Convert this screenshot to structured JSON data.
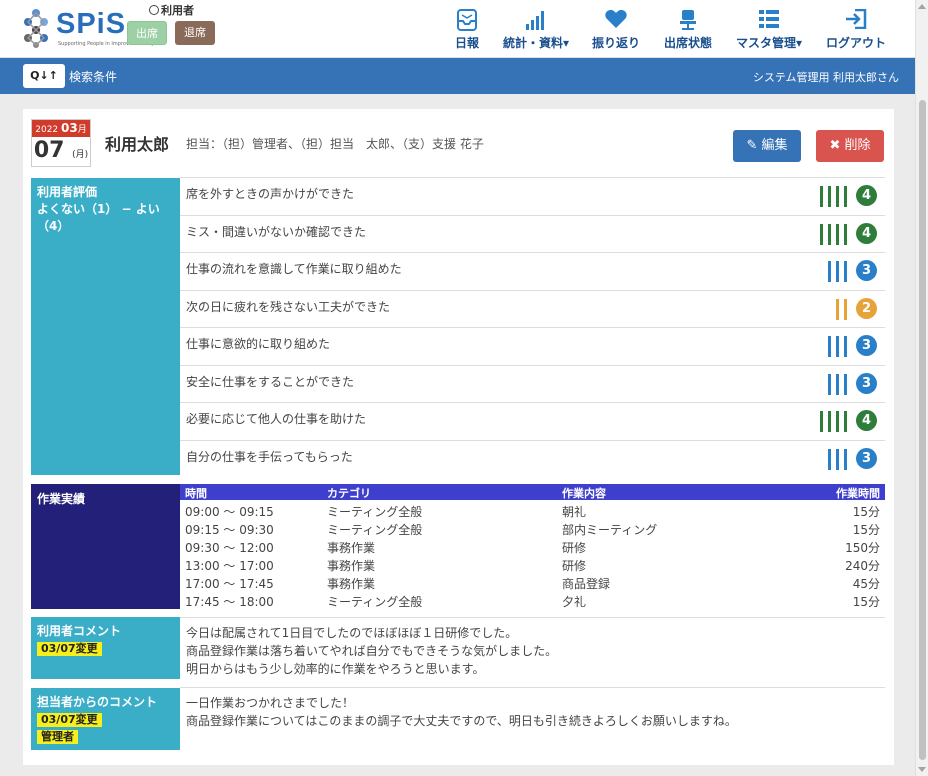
{
  "header": {
    "logo_text": "SPiS",
    "logo_sub": "Supporting People in Improve Stability",
    "user_label": "利用者",
    "btn_in": "出席",
    "btn_out": "退席",
    "nav": [
      {
        "label": "日報",
        "icon": "inbox-icon"
      },
      {
        "label": "統計・資料▾",
        "icon": "bar-chart-icon"
      },
      {
        "label": "振り返り",
        "icon": "heart-icon"
      },
      {
        "label": "出席状態",
        "icon": "chair-icon"
      },
      {
        "label": "マスタ管理▾",
        "icon": "list-icon"
      },
      {
        "label": "ログアウト",
        "icon": "logout-icon"
      }
    ]
  },
  "subbar": {
    "search_button": "Q↓↑",
    "search_label": "検索条件",
    "system_user": "システム管理用 利用太郎さん"
  },
  "report": {
    "date": {
      "year": "2022",
      "month": "03",
      "month_suffix": "月",
      "day": "07",
      "weekday": "(月)"
    },
    "name": "利用太郎",
    "staff": "担当：（担）管理者、（担）担当　太郎、（支）支援 花子",
    "edit_label": "編集",
    "delete_label": "削除"
  },
  "evaluation": {
    "label_line1": "利用者評価",
    "label_line2": "よくない（1） − よい（4）",
    "items": [
      {
        "text": "席を外すときの声かけができた",
        "score": 4
      },
      {
        "text": "ミス・間違いがないか確認できた",
        "score": 4
      },
      {
        "text": "仕事の流れを意識して作業に取り組めた",
        "score": 3
      },
      {
        "text": "次の日に疲れを残さない工夫ができた",
        "score": 2
      },
      {
        "text": "仕事に意欲的に取り組めた",
        "score": 3
      },
      {
        "text": "安全に仕事をすることができた",
        "score": 3
      },
      {
        "text": "必要に応じて他人の仕事を助けた",
        "score": 4
      },
      {
        "text": "自分の仕事を手伝ってもらった",
        "score": 3
      }
    ],
    "score_colors": {
      "2": "#e8a23a",
      "3": "#2a7fc9",
      "4": "#2e7d3a"
    }
  },
  "work": {
    "label": "作業実績",
    "headers": [
      "時間",
      "カテゴリ",
      "作業内容",
      "作業時間"
    ],
    "rows": [
      [
        "09:00 〜 09:15",
        "ミーティング全般",
        "朝礼",
        "15分"
      ],
      [
        "09:15 〜 09:30",
        "ミーティング全般",
        "部内ミーティング",
        "15分"
      ],
      [
        "09:30 〜 12:00",
        "事務作業",
        "研修",
        "150分"
      ],
      [
        "13:00 〜 17:00",
        "事務作業",
        "研修",
        "240分"
      ],
      [
        "17:00 〜 17:45",
        "事務作業",
        "商品登録",
        "45分"
      ],
      [
        "17:45 〜 18:00",
        "ミーティング全般",
        "夕礼",
        "15分"
      ]
    ]
  },
  "user_comment": {
    "label": "利用者コメント",
    "badge": "03/07変更",
    "lines": [
      "今日は配属されて1日目でしたのでほぼほぼ１日研修でした。",
      "商品登録作業は落ち着いてやれば自分でもできそうな気がしました。",
      "明日からはもう少し効率的に作業をやろうと思います。"
    ]
  },
  "staff_comment": {
    "label": "担当者からのコメント",
    "badge": "03/07変更",
    "badge2": "管理者",
    "lines": [
      "一日作業おつかれさまでした！",
      "商品登録作業についてはこのままの調子で大丈夫ですので、明日も引き続きよろしくお願いしますね。"
    ]
  }
}
